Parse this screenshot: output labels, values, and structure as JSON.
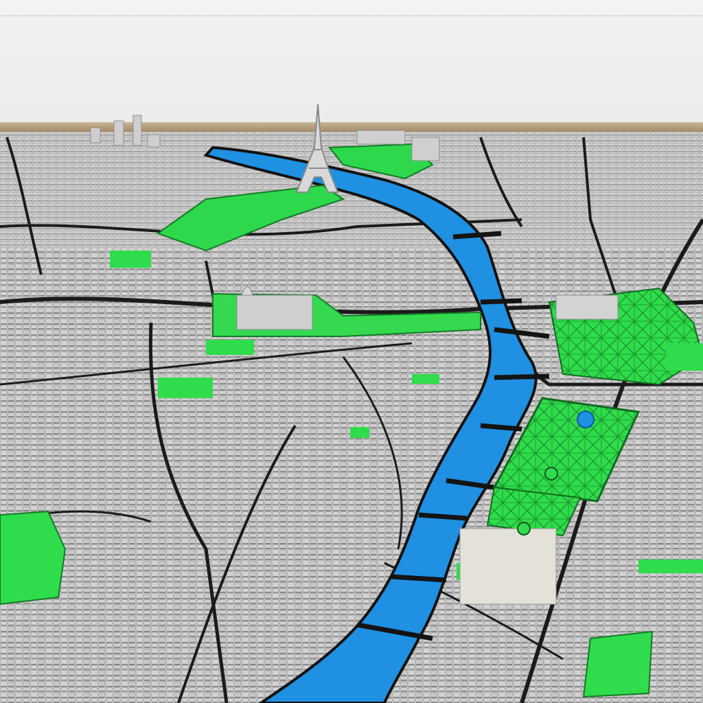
{
  "scene": {
    "description_label": "",
    "colors": {
      "wall": "#efefed",
      "frame": "#b89f7c",
      "buildings": "#bdbdbd",
      "building_shadow": "#8d8d8d",
      "roads": "#1e1e1e",
      "river": "#1e8fe0",
      "parks": "#2de04a"
    },
    "icons": [
      "eiffel-tower-icon"
    ]
  }
}
